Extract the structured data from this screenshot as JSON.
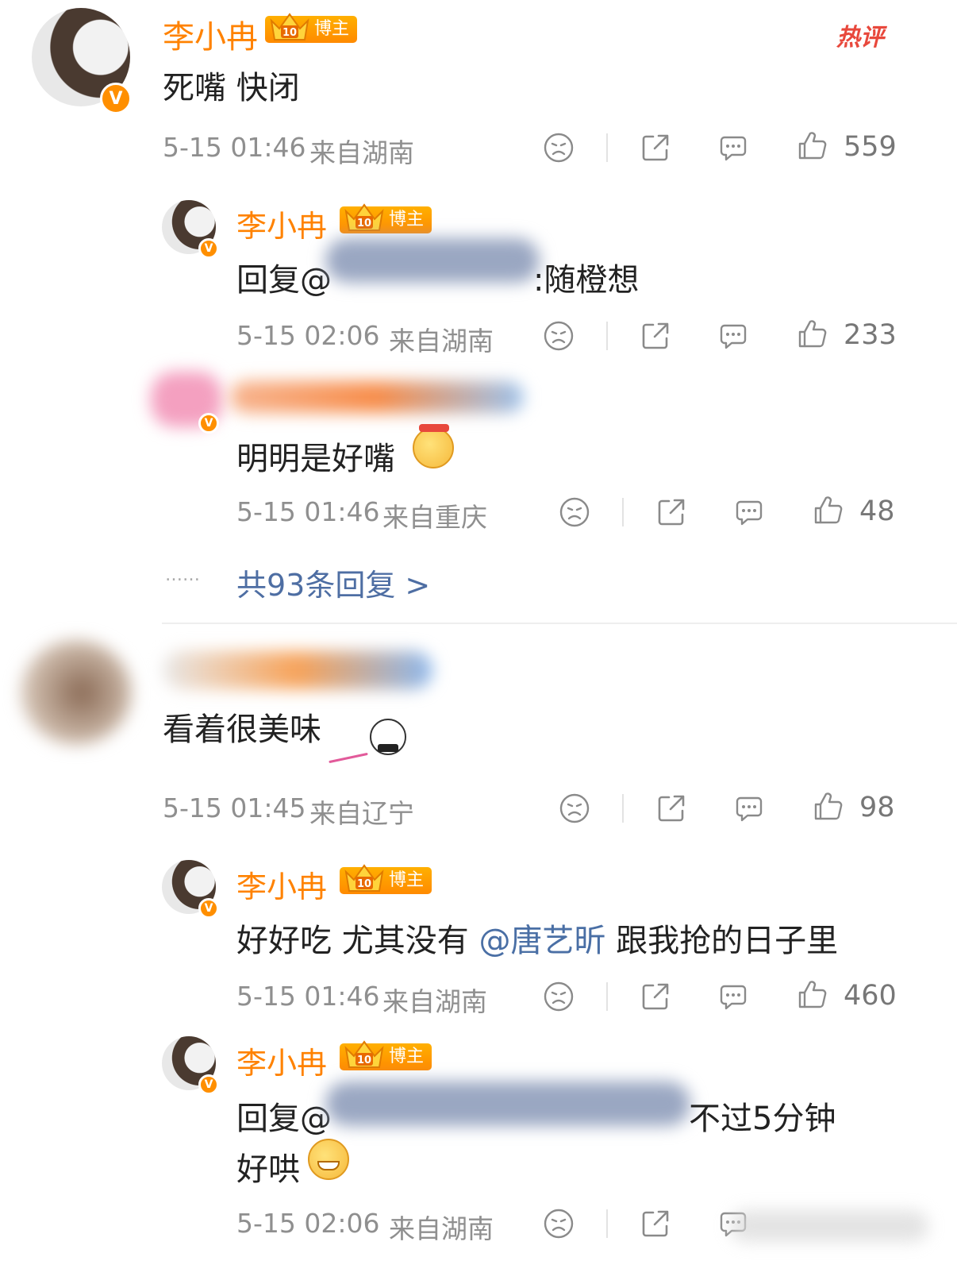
{
  "hot_tag": "热评",
  "comments": [
    {
      "author": "李小冉",
      "badge": "博主",
      "text": "死嘴 快闭",
      "time": "5-15 01:46",
      "location": "来自湖南",
      "likes": "559",
      "replies": [
        {
          "author": "李小冉",
          "badge": "博主",
          "prefix": "回复@",
          "text_tail": ":随橙想",
          "time": "5-15 02:06",
          "location": "来自湖南",
          "likes": "233"
        },
        {
          "text": "明明是好嘴",
          "time": "5-15 01:46",
          "location": "来自重庆",
          "likes": "48"
        }
      ],
      "more_replies": "共93条回复 >",
      "more_dots": "……"
    },
    {
      "text": "看着很美味",
      "time": "5-15 01:45",
      "location": "来自辽宁",
      "likes": "98",
      "replies": [
        {
          "author": "李小冉",
          "badge": "博主",
          "text_before": "好好吃 尤其没有 ",
          "mention": "@唐艺昕",
          "text_after": " 跟我抢的日子里",
          "time": "5-15 01:46",
          "location": "来自湖南",
          "likes": "460"
        },
        {
          "author": "李小冉",
          "badge": "博主",
          "prefix": "回复@",
          "text_tail": "不过5分钟",
          "text_line2": "好哄",
          "time": "5-15 02:06",
          "location": "来自湖南"
        }
      ]
    }
  ],
  "icons": [
    "dislike-icon",
    "share-icon",
    "comment-icon",
    "like-icon"
  ],
  "colors": {
    "name": "#ff8200",
    "meta": "#8f8f8f",
    "mention": "#4a6fa5",
    "hot": "#e8483c"
  }
}
